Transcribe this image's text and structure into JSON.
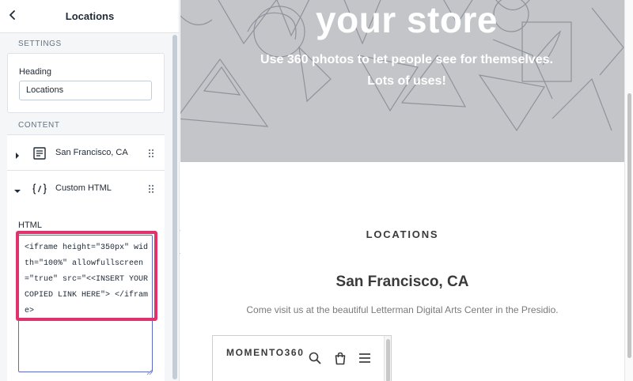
{
  "panel": {
    "title": "Locations",
    "back_icon": "chevron-left-icon",
    "settings_label": "SETTINGS",
    "heading_label": "Heading",
    "heading_value": "Locations",
    "content_label": "CONTENT",
    "blocks": [
      {
        "label": "San Francisco, CA",
        "icon": "text-block-icon",
        "expanded": false
      },
      {
        "label": "Custom HTML",
        "icon": "code-block-icon",
        "expanded": true
      }
    ],
    "html_label": "HTML",
    "html_value": "<iframe height=\"350px\" width=\"100%\" allowfullscreen=\"true\" src=\"<<INSERT YOUR COPIED LINK HERE\"> </iframe>",
    "highlight_color": "#e0336c"
  },
  "preview": {
    "hero_title": "your store",
    "hero_subtitle": "Use 360 photos to let people see for themselves. Lots of uses!",
    "section_heading": "LOCATIONS",
    "location_title": "San Francisco, CA",
    "location_description": "Come visit us at the beautiful Letterman Digital Arts Center in the Presidio.",
    "embed": {
      "brand": "MOMENTO360",
      "icons": [
        "search-icon",
        "cart-icon",
        "menu-icon"
      ]
    }
  },
  "colors": {
    "accent": "#5c6ac4",
    "hero_background": "#c3c5c9"
  }
}
